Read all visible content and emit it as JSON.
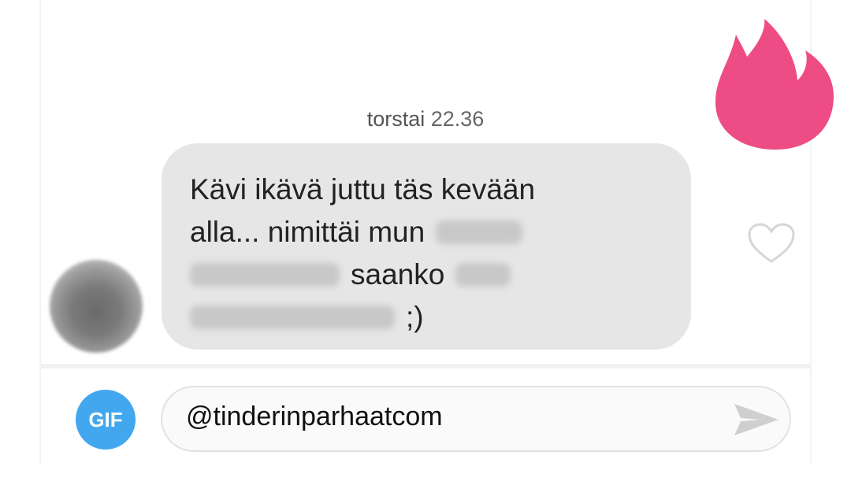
{
  "colors": {
    "bubble": "#e6e6e6",
    "gif_button": "#43a7ef",
    "flame": "#ee4c84",
    "send_icon": "#cfcfcf"
  },
  "conversation": {
    "day": "torstai",
    "time": "22.36",
    "message": {
      "line1": "Kävi ikävä juttu täs kevään",
      "line2": "alla... nimittäi mun",
      "line3_end": "saanko",
      "line4_end": ";)"
    }
  },
  "composer": {
    "gif_label": "GIF",
    "input_value": "@tinderinparhaatcom"
  },
  "icons": {
    "logo": "tinder-flame-icon",
    "like": "heart-outline-icon",
    "send": "send-arrow-icon"
  }
}
